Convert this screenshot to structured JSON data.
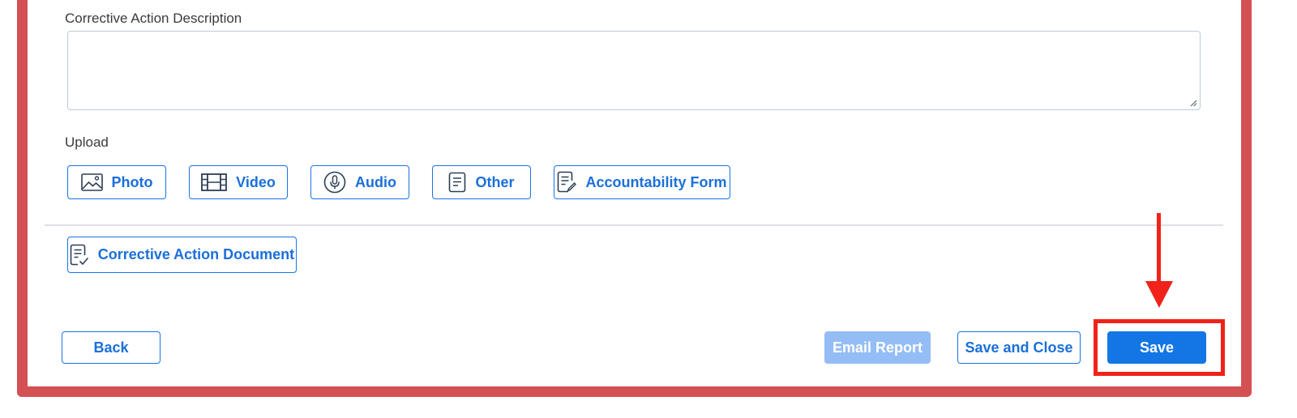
{
  "form": {
    "description_label": "Corrective Action Description",
    "description_value": "",
    "upload_label": "Upload"
  },
  "upload_buttons": {
    "photo": {
      "label": "Photo",
      "icon": "image-icon"
    },
    "video": {
      "label": "Video",
      "icon": "film-icon"
    },
    "audio": {
      "label": "Audio",
      "icon": "microphone-icon"
    },
    "other": {
      "label": "Other",
      "icon": "document-icon"
    },
    "accountability": {
      "label": "Accountability Form",
      "icon": "form-edit-icon"
    }
  },
  "corrective_doc": {
    "label": "Corrective Action Document",
    "icon": "document-check-icon"
  },
  "footer": {
    "back_label": "Back",
    "email_label": "Email Report",
    "save_close_label": "Save and Close",
    "save_label": "Save"
  },
  "colors": {
    "accent": "#1a73e8",
    "frame": "#d45153",
    "annotation": "#f0221a",
    "disabled": "#94bdf5"
  },
  "annotation": {
    "highlighted": "save-button",
    "arrow": "down-arrow-annotation"
  }
}
